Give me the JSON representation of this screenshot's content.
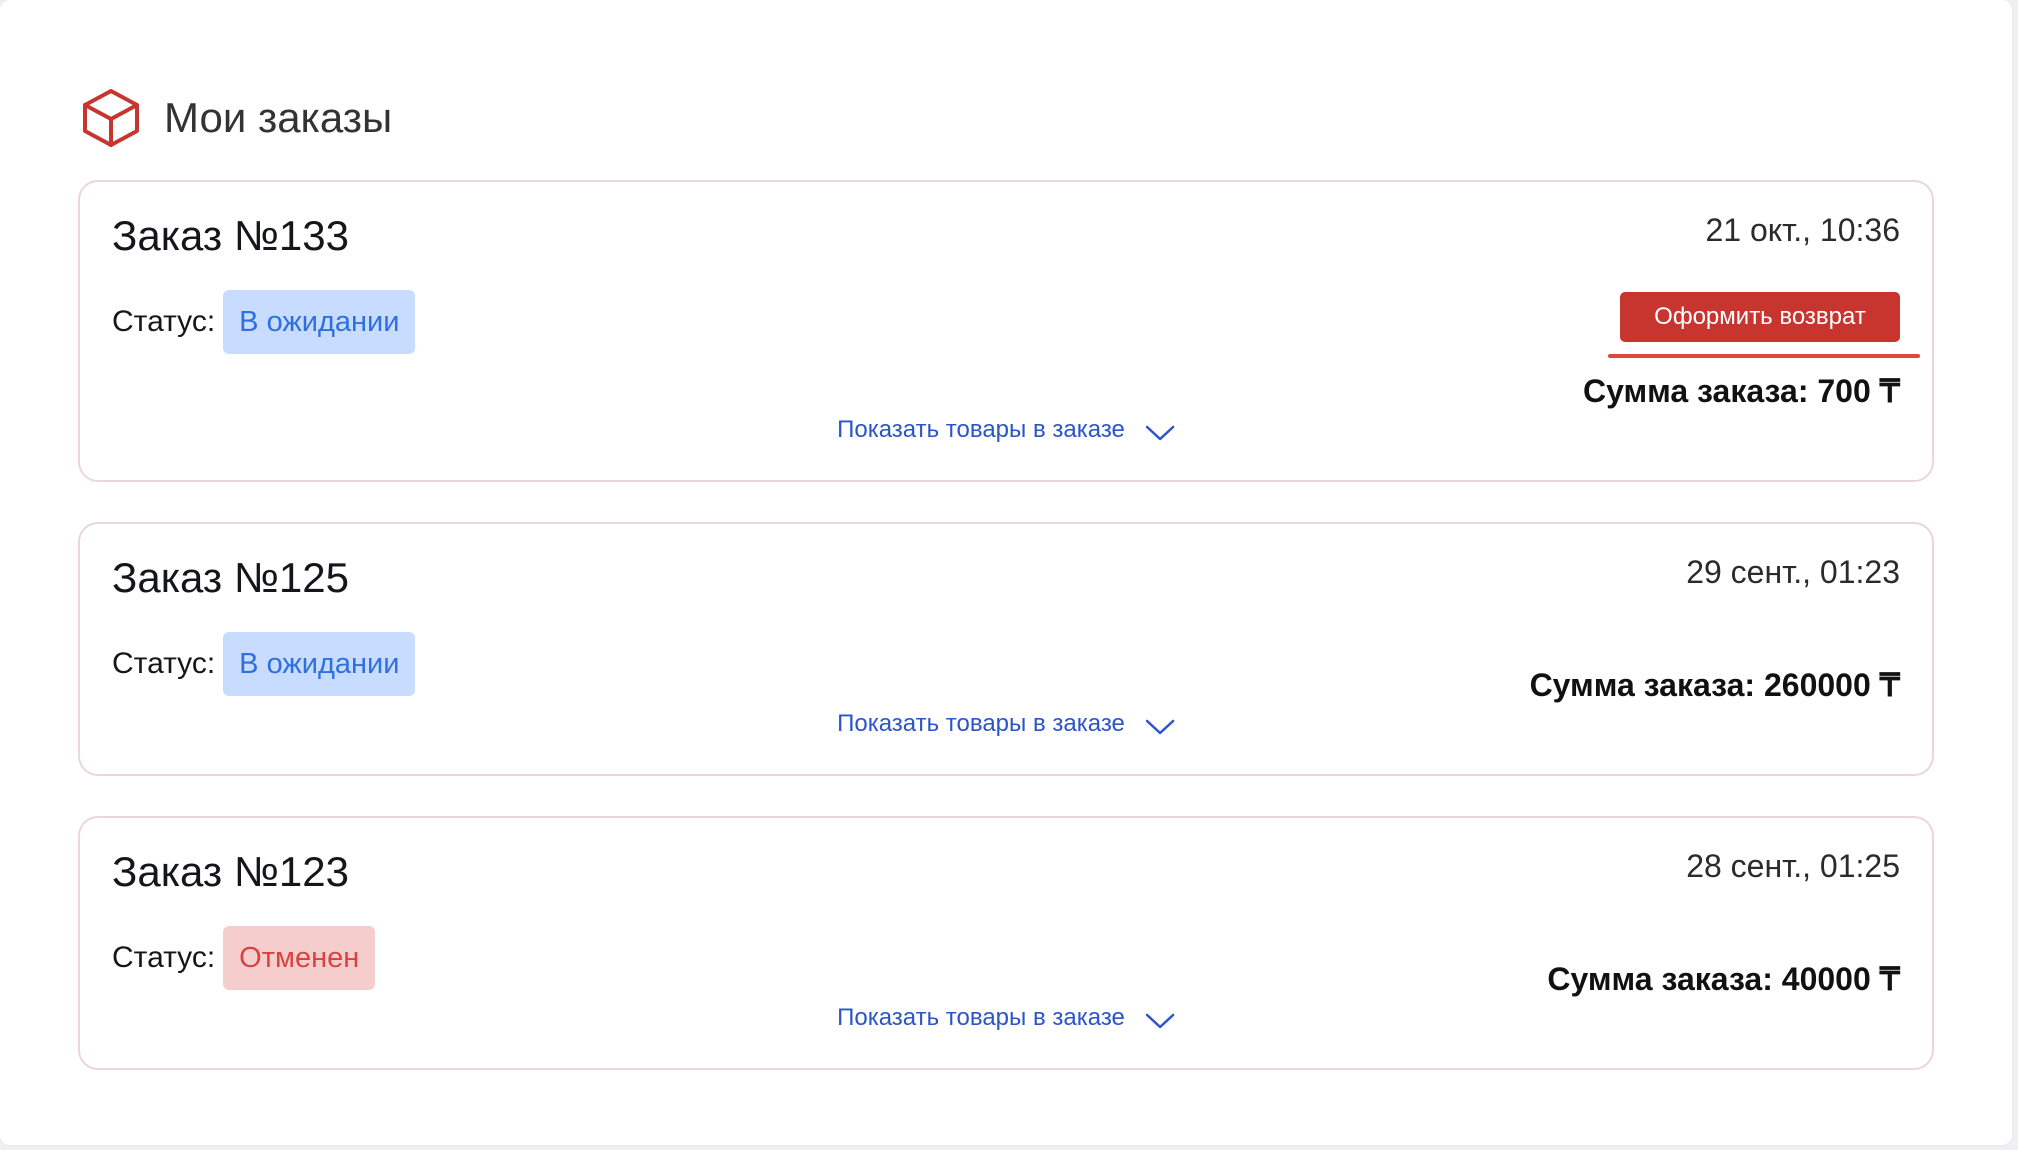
{
  "page": {
    "title": "Мои заказы",
    "icon": "box-icon"
  },
  "orders": [
    {
      "title": "Заказ №133",
      "date": "21 окт., 10:36",
      "status_label": "Статус:",
      "status": "В ожидании",
      "status_type": "pending",
      "return_button": "Оформить возврат",
      "sum": "Сумма заказа: 700 ₸",
      "show_items": "Показать товары в заказе"
    },
    {
      "title": "Заказ №125",
      "date": "29 сент., 01:23",
      "status_label": "Статус:",
      "status": "В ожидании",
      "status_type": "pending",
      "sum": "Сумма заказа: 260000 ₸",
      "show_items": "Показать товары в заказе"
    },
    {
      "title": "Заказ №123",
      "date": "28 сент., 01:25",
      "status_label": "Статус:",
      "status": "Отменен",
      "status_type": "cancelled",
      "sum": "Сумма заказа: 40000 ₸",
      "show_items": "Показать товары в заказе"
    }
  ],
  "colors": {
    "accent": "#c8352f",
    "pending_bg": "#c7dcff",
    "pending_text": "#2f6fe0",
    "cancelled_bg": "#f6cdcd",
    "cancelled_text": "#d8433f",
    "link": "#2b55c8"
  }
}
